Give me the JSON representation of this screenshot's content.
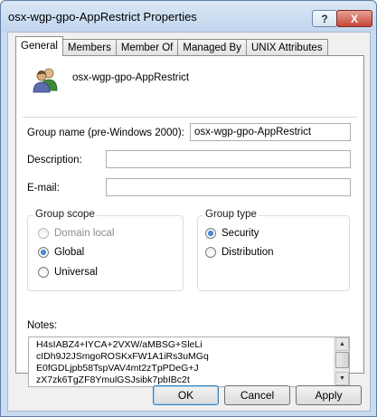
{
  "window": {
    "title": "osx-wgp-gpo-AppRestrict Properties",
    "help_label": "?",
    "close_label": "X"
  },
  "tabs": [
    {
      "label": "General",
      "active": true
    },
    {
      "label": "Members"
    },
    {
      "label": "Member Of"
    },
    {
      "label": "Managed By"
    },
    {
      "label": "UNIX Attributes"
    }
  ],
  "general": {
    "object_name": "osx-wgp-gpo-AppRestrict",
    "group_name_label": "Group name (pre-Windows 2000):",
    "group_name_value": "osx-wgp-gpo-AppRestrict",
    "description_label": "Description:",
    "description_value": "",
    "email_label": "E-mail:",
    "email_value": "",
    "group_scope": {
      "legend": "Group scope",
      "options": [
        {
          "label": "Domain local",
          "checked": false,
          "disabled": true
        },
        {
          "label": "Global",
          "checked": true,
          "disabled": false
        },
        {
          "label": "Universal",
          "checked": false,
          "disabled": false
        }
      ]
    },
    "group_type": {
      "legend": "Group type",
      "options": [
        {
          "label": "Security",
          "checked": true
        },
        {
          "label": "Distribution",
          "checked": false
        }
      ]
    },
    "notes_label": "Notes:",
    "notes_value": "H4sIABZ4+IYCA+2VXW/aMBSG+SleLi\ncIDh9J2JSmgoROSKxFW1A1iRs3uMGq\nE0fGDLjpb58TspVAV4mt2zTpPDeG+J\nzX7zk6TgZF8YmulGSJsibk7pbIBc2t"
  },
  "buttons": {
    "ok": "OK",
    "cancel": "Cancel",
    "apply": "Apply"
  }
}
